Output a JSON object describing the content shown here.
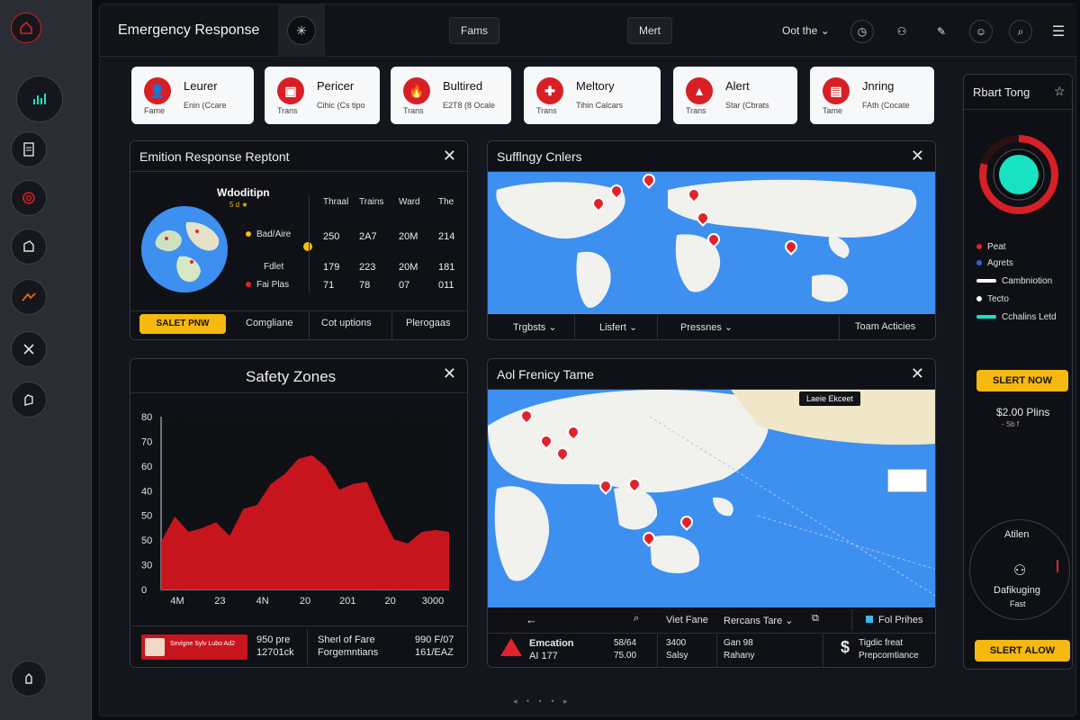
{
  "app": {
    "title": "Emergency Response"
  },
  "topbar": {
    "btn1": "Fams",
    "btn2": "Mert",
    "dropdown": "Oot the",
    "icons": [
      "chat-icon",
      "users-icon",
      "pen-icon",
      "user-icon",
      "search-icon",
      "menu-icon"
    ]
  },
  "rail": {
    "items": [
      "home-icon",
      "chart-icon",
      "document-icon",
      "target-icon",
      "edit-icon",
      "trend-icon",
      "close-icon",
      "hand-icon",
      "settings-icon"
    ]
  },
  "cards": [
    {
      "title": "Leurer",
      "sub1": "Fame",
      "sub2": "Enin (Ccare",
      "icon": "person-icon"
    },
    {
      "title": "Pericer",
      "sub1": "Trans",
      "sub2": "Cihic (Cs tipo",
      "icon": "alert-box-icon"
    },
    {
      "title": "Bultired",
      "sub1": "Trans",
      "sub2": "E2T8 (8 Ocale",
      "icon": "fire-icon"
    },
    {
      "title": "Meltory",
      "sub1": "Trans",
      "sub2": "Tihin Calcars",
      "icon": "medical-icon"
    },
    {
      "title": "Alert",
      "sub1": "Trans",
      "sub2": "Star (Cbrats",
      "icon": "warning-icon"
    },
    {
      "title": "Jnring",
      "sub1": "Tame",
      "sub2": "FAth (Cocate",
      "icon": "clipboard-icon"
    }
  ],
  "report": {
    "title": "Emition Response Reptont",
    "globe_title": "Wdoditipn",
    "globe_sub": "5 d ★",
    "legend": [
      "Bad/Aire",
      "Fdlet",
      "Fai Plas"
    ],
    "columns": [
      "Thraal",
      "Trains",
      "Ward",
      "The"
    ],
    "rows": [
      [
        "250",
        "2A7",
        "20M",
        "214"
      ],
      [
        "179",
        "223",
        "20M",
        "181"
      ],
      [
        "71",
        "78",
        "07",
        "011"
      ]
    ],
    "tabs": [
      "SALET PNW",
      "Comgliane",
      "Cot uptions",
      "Plerogaas"
    ]
  },
  "map1": {
    "title": "Sufflngy Cnlers",
    "tabs": [
      "Trgbsts",
      "Lisfert",
      "Pressnes",
      "Toam Acticies"
    ]
  },
  "safety": {
    "title": "Safety Zones",
    "y_ticks": [
      "80",
      "70",
      "60",
      "40",
      "50",
      "50",
      "30",
      "0"
    ],
    "x_ticks": [
      "4M",
      "23",
      "4N",
      "20",
      "201",
      "20",
      "3000"
    ],
    "footer": {
      "badge_text": "Sevigne Sylv Lubo Ad2",
      "col1_a": "950 pre",
      "col1_b": "12701ck",
      "col2_a": "Sherl of Fare",
      "col2_b": "Forgemntians",
      "col3_a": "990 F/07",
      "col3_b": "161/EAZ"
    }
  },
  "chart_data": {
    "type": "area",
    "title": "Safety Zones",
    "xlabel": "",
    "ylabel": "",
    "x": [
      "4M",
      "23",
      "4N",
      "20",
      "201",
      "20",
      "3000"
    ],
    "series": [
      {
        "values": [
          25,
          38,
          30,
          32,
          35,
          28,
          42,
          44,
          55,
          60,
          68,
          70,
          64,
          52,
          55,
          56,
          40,
          26,
          24,
          30,
          31,
          30
        ]
      }
    ],
    "ylim": [
      0,
      90
    ],
    "grid": false,
    "color": "#d0161f"
  },
  "map2": {
    "title": "Aol Frenicy Tame",
    "popup": "Laeie Ekceet",
    "toolbar": [
      "Viet Fane",
      "Rercans Tare",
      "Fol Prihes"
    ],
    "footer": {
      "col1_a": "Emcation",
      "col1_b": "AI 177",
      "col2_a": "58/64",
      "col2_b": "75.00",
      "col3_a": "3400",
      "col3_b": "Salsy",
      "col4_a": "Gan 98",
      "col4_b": "Rahany",
      "col5_a": "Tigdic freat",
      "col5_b": "Prepcomtiance"
    }
  },
  "right": {
    "title": "Rbart Tong",
    "legend": [
      {
        "label": "Peat",
        "color": "#e0232b"
      },
      {
        "label": "Agrets",
        "color": "#3b5bdb"
      },
      {
        "label": "Cambniotion",
        "color": "#ffffff"
      },
      {
        "label": "Tecto",
        "color": "#ffffff"
      },
      {
        "label": "Cchalins Letd",
        "color": "#17e3c3"
      }
    ],
    "btn1": "SLERT NOW",
    "price": "$2.00 Plins",
    "price_sub": "- Sb f",
    "circle_title": "Atilen",
    "circle_label": "Dafikuging",
    "circle_sub": "Fast",
    "btn2": "SLERT ALOW"
  }
}
